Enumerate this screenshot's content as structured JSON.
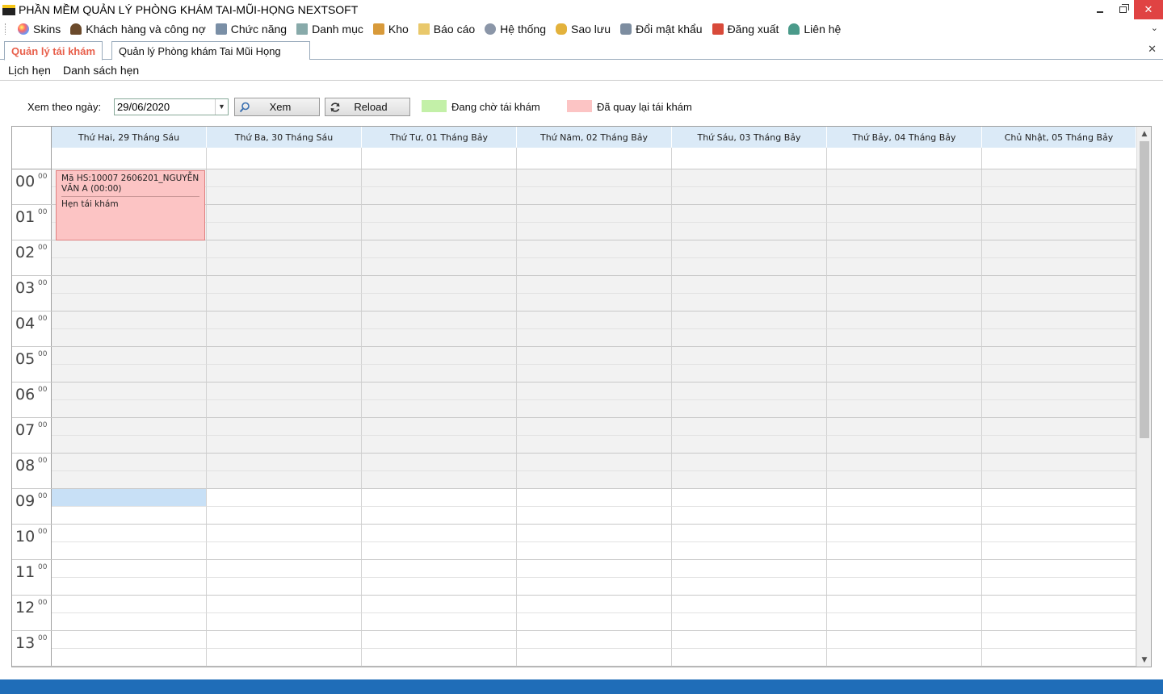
{
  "window": {
    "title": "PHẦN MỀM QUẢN LÝ PHÒNG KHÁM TAI-MŨI-HỌNG NEXTSOFT",
    "minimize_glyph": "",
    "close_glyph": "✕"
  },
  "menu": {
    "items": [
      {
        "label": "Skins",
        "icon": "palette-icon"
      },
      {
        "label": "Khách hàng và công nợ",
        "icon": "user-icon"
      },
      {
        "label": "Chức năng",
        "icon": "function-icon"
      },
      {
        "label": "Danh mục",
        "icon": "catalog-icon"
      },
      {
        "label": "Kho",
        "icon": "box-icon"
      },
      {
        "label": "Báo cáo",
        "icon": "report-icon"
      },
      {
        "label": "Hệ thống",
        "icon": "gears-icon"
      },
      {
        "label": "Sao lưu",
        "icon": "database-icon"
      },
      {
        "label": "Đổi mật khẩu",
        "icon": "key-icon"
      },
      {
        "label": "Đăng xuất",
        "icon": "logout-icon"
      },
      {
        "label": "Liên hệ",
        "icon": "contact-icon"
      }
    ]
  },
  "tabs": {
    "active": "Quản lý tái khám",
    "inactive": "Quản lý Phòng khám Tai Mũi Họng",
    "close_glyph": "✕"
  },
  "subtabs": {
    "schedule": "Lịch hẹn",
    "list": "Danh sách hẹn"
  },
  "toolbar": {
    "date_label": "Xem theo ngày:",
    "date_value": "29/06/2020",
    "view_button": "Xem",
    "reload_button": "Reload",
    "legend_waiting": "Đang chờ tái khám",
    "legend_returned": "Đã quay lại tái khám",
    "colors": {
      "waiting": "#c3f0a8",
      "returned": "#fcc4c4"
    }
  },
  "scheduler": {
    "days": [
      "Thứ Hai, 29 Tháng Sáu",
      "Thứ Ba, 30 Tháng Sáu",
      "Thứ Tư, 01 Tháng Bảy",
      "Thứ Năm, 02 Tháng Bảy",
      "Thứ Sáu, 03 Tháng Bảy",
      "Thứ Bảy, 04 Tháng Bảy",
      "Chủ Nhật, 05 Tháng Bảy"
    ],
    "hours": [
      "00",
      "01",
      "02",
      "03",
      "04",
      "05",
      "06",
      "07",
      "08",
      "09",
      "10",
      "11",
      "12",
      "13"
    ],
    "minute_label": "00",
    "appointment": {
      "title": "Mã HS:10007 2606201_NGUYỄN VĂN A (00:00)",
      "description": "Hẹn tái khám"
    }
  }
}
